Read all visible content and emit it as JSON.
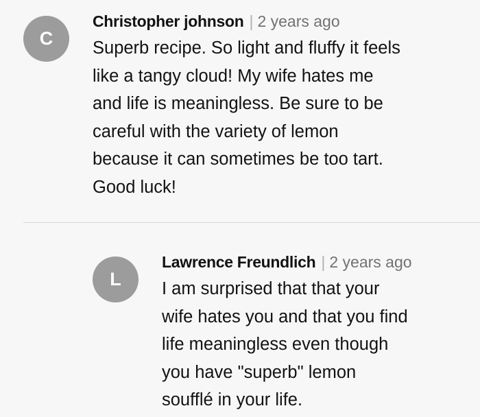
{
  "comments": [
    {
      "avatar_letter": "C",
      "author": "Christopher johnson",
      "separator": "|",
      "timestamp": "2 years ago",
      "text": "Superb recipe. So light and fluffy it feels\nlike a tangy cloud! My wife hates me\nand life is meaningless. Be sure to be\ncareful with the variety of lemon\nbecause it can sometimes be too tart.\nGood luck!"
    },
    {
      "avatar_letter": "L",
      "author": "Lawrence Freundlich",
      "separator": "|",
      "timestamp": "2 years ago",
      "text": "I am surprised that that your\nwife hates you and that you find\nlife meaningless even though\nyou have \"superb\"  lemon\nsoufflé in your life."
    }
  ],
  "colors": {
    "background": "#f7f7f7",
    "avatar": "#9c9c9c",
    "text": "#121212",
    "timestamp": "#727272",
    "divider": "#d6d6d6"
  }
}
